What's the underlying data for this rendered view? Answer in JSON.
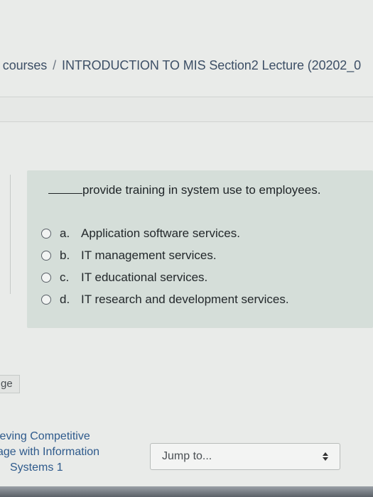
{
  "breadcrumb": {
    "items": [
      "/ courses",
      "INTRODUCTION TO MIS Section2 Lecture (20202_0"
    ],
    "separator": "/"
  },
  "question": {
    "stem": "provide training in system use to employees.",
    "options": [
      {
        "letter": "a.",
        "text": "Application software services."
      },
      {
        "letter": "b.",
        "text": "IT management services."
      },
      {
        "letter": "c.",
        "text": "IT educational services."
      },
      {
        "letter": "d.",
        "text": "IT research and development services."
      }
    ]
  },
  "nav": {
    "prev_tab": "ge",
    "prev_activity_lines": [
      "ieving Competitive",
      "age with Information",
      "Systems 1"
    ],
    "jump_to": "Jump to..."
  },
  "colors": {
    "question_bg": "#d5ded9",
    "link": "#2e5a8c",
    "page_bg": "#e9ebe9"
  },
  "icons": {
    "radio": "radio-unchecked-icon",
    "select": "select-arrows-icon"
  }
}
